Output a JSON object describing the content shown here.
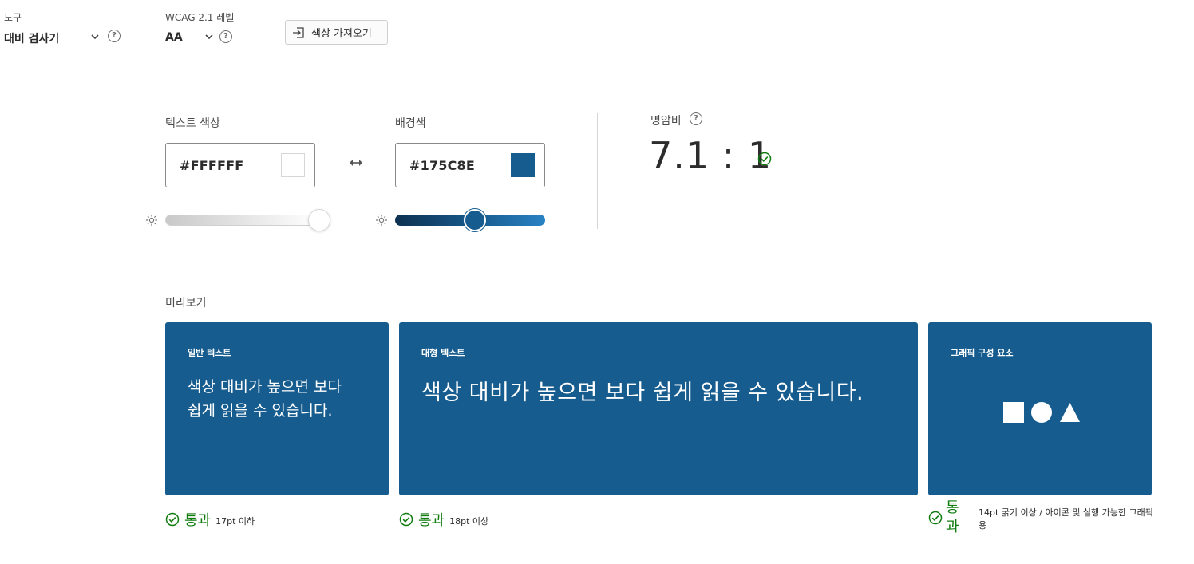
{
  "toolbar": {
    "tool_label": "도구",
    "tool_value": "대비 검사기",
    "wcag_label": "WCAG 2.1 레벨",
    "wcag_value": "AA",
    "import_button": "색상 가져오기"
  },
  "colors": {
    "text_label": "텍스트 색상",
    "text_hex": "#FFFFFF",
    "background_label": "배경색",
    "background_hex": "#175C8E",
    "accent": "#175c8e",
    "pass_color": "#107c10"
  },
  "ratio": {
    "label": "명암비",
    "value": "7.1 : 1",
    "status": "pass"
  },
  "preview": {
    "label": "미리보기",
    "normal": {
      "title": "일반 텍스트",
      "sample": "색상 대비가 높으면 보다 쉽게 읽을 수 있습니다.",
      "result": "통과",
      "note": "17pt 이하"
    },
    "large": {
      "title": "대형 텍스트",
      "sample": "색상 대비가 높으면 보다 쉽게 읽을 수 있습니다.",
      "result": "통과",
      "note": "18pt 이상"
    },
    "graphic": {
      "title": "그래픽 구성 요소",
      "result_line1": "통",
      "result_line2": "과",
      "note": "14pt 굵기 이상 / 아이콘 및 실행 가능한 그래픽용"
    }
  },
  "icons": [
    "chevron-down-icon",
    "help-icon",
    "import-icon",
    "swap-icon",
    "brightness-icon",
    "check-circle-icon",
    "square-icon",
    "circle-icon",
    "triangle-icon"
  ]
}
